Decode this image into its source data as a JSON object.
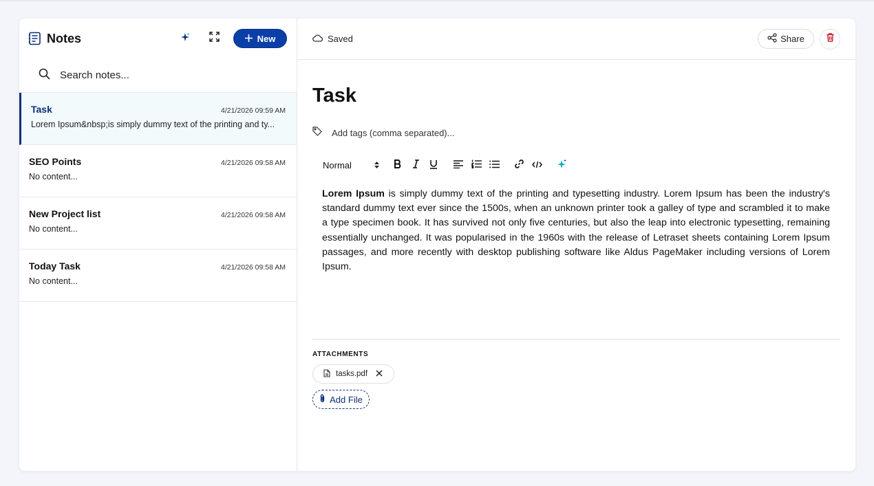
{
  "sidebar": {
    "title": "Notes",
    "new_label": "New",
    "search_placeholder": "Search notes...",
    "notes": [
      {
        "title": "Task",
        "date": "4/21/2026 09:59 AM",
        "preview": "Lorem Ipsum&nbsp;is simply dummy text of the printing and ty...",
        "active": true
      },
      {
        "title": "SEO Points",
        "date": "4/21/2026 09:58 AM",
        "preview": "No content...",
        "active": false
      },
      {
        "title": "New Project list",
        "date": "4/21/2026 09:58 AM",
        "preview": "No content...",
        "active": false
      },
      {
        "title": "Today Task",
        "date": "4/21/2026 09:58 AM",
        "preview": "No content...",
        "active": false
      }
    ]
  },
  "header": {
    "status": "Saved",
    "share_label": "Share"
  },
  "editor": {
    "title": "Task",
    "tags_placeholder": "Add tags (comma separated)...",
    "format_select": "Normal",
    "body_bold": "Lorem Ipsum",
    "body_rest": " is simply dummy text of the printing and typesetting industry. Lorem Ipsum has been the industry's standard dummy text ever since the 1500s, when an unknown printer took a galley of type and scrambled it to make a type specimen book. It has survived not only five centuries, but also the leap into electronic typesetting, remaining essentially unchanged. It was popularised in the 1960s with the release of Letraset sheets containing Lorem Ipsum passages, and more recently with desktop publishing software like Aldus PageMaker including versions of Lorem Ipsum."
  },
  "attachments": {
    "label": "ATTACHMENTS",
    "files": [
      "tasks.pdf"
    ],
    "add_label": "Add File"
  },
  "colors": {
    "accent": "#0b3fa8",
    "active_title": "#0b2f78",
    "delete": "#c8202f",
    "ai_sparkle": "#14b0c4"
  }
}
